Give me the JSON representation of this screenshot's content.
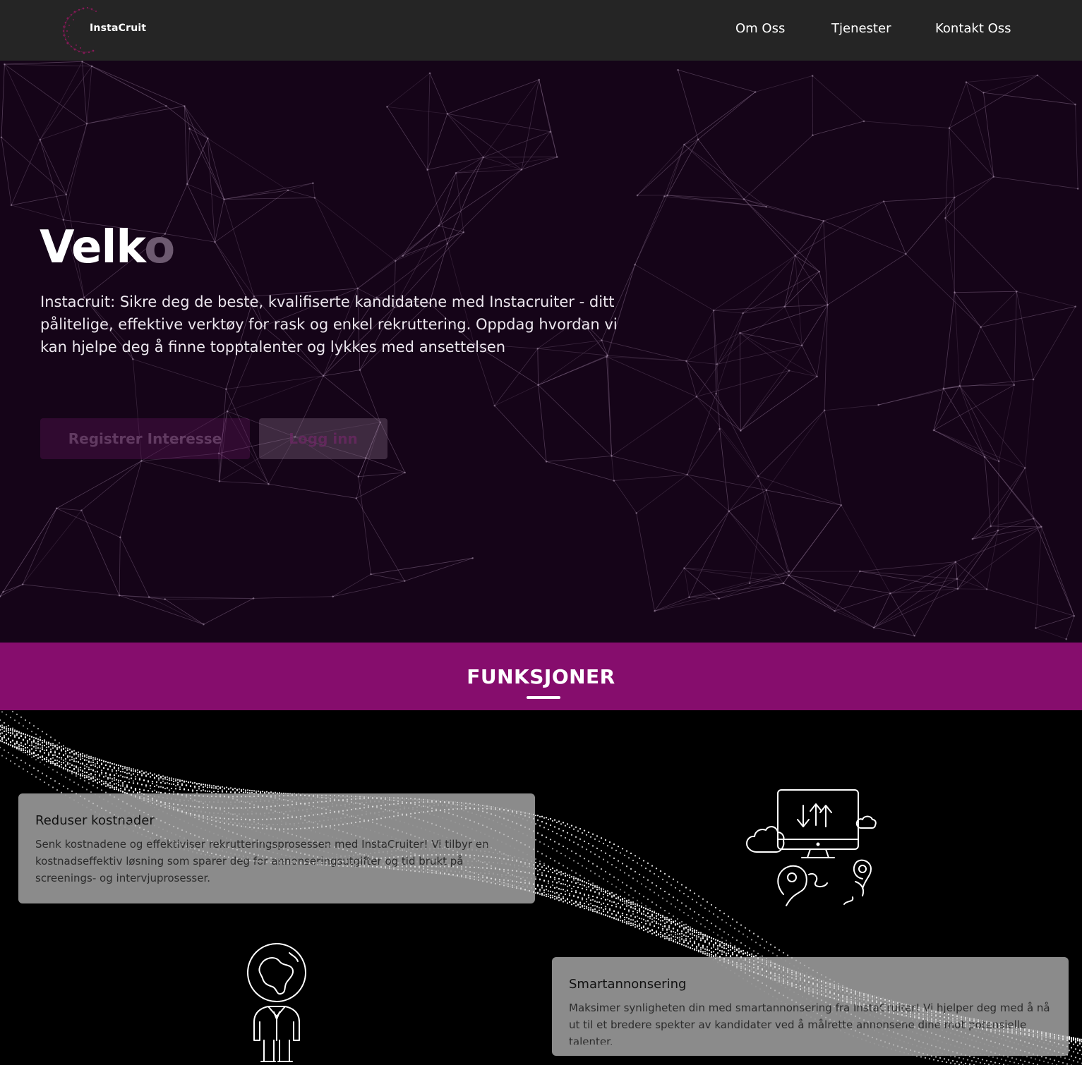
{
  "nav": {
    "brand": "InstaCruit",
    "links": [
      "Om Oss",
      "Tjenester",
      "Kontakt Oss"
    ]
  },
  "hero": {
    "title_visible": "Velk",
    "title_fading": "o",
    "description": "Instacruit: Sikre deg de beste, kvalifiserte kandidatene med Instacruiter - ditt pålitelige, effektive verktøy for rask og enkel rekruttering. Oppdag hvordan vi kan hjelpe deg å finne topptalenter og lykkes med ansettelsen",
    "register_label": "Registrer Interesse",
    "login_label": "Logg inn"
  },
  "features": {
    "heading": "FUNKSJONER",
    "cards": [
      {
        "title": "Reduser kostnader",
        "text": "Senk kostnadene og effektiviser rekrutteringsprosessen med InstaCruiter! Vi tilbyr en kostnadseffektiv løsning som sparer deg for annonseringsutgifter og tid brukt på screenings- og intervjuprosesser."
      },
      {
        "title": "Smartannonsering",
        "text": "Maksimer synligheten din med smartannonsering fra InstaCruiter! Vi hjelper deg med å nå ut til et bredere spekter av kandidater ved å målrette annonsene dine mot potensielle talenter."
      }
    ],
    "icons": [
      "cloud-computer-icon",
      "globe-head-person-icon"
    ]
  },
  "colors": {
    "nav_bg": "#252525",
    "hero_bg": "#150418",
    "band_bg": "#860d6d",
    "card_bg": "#969696"
  }
}
